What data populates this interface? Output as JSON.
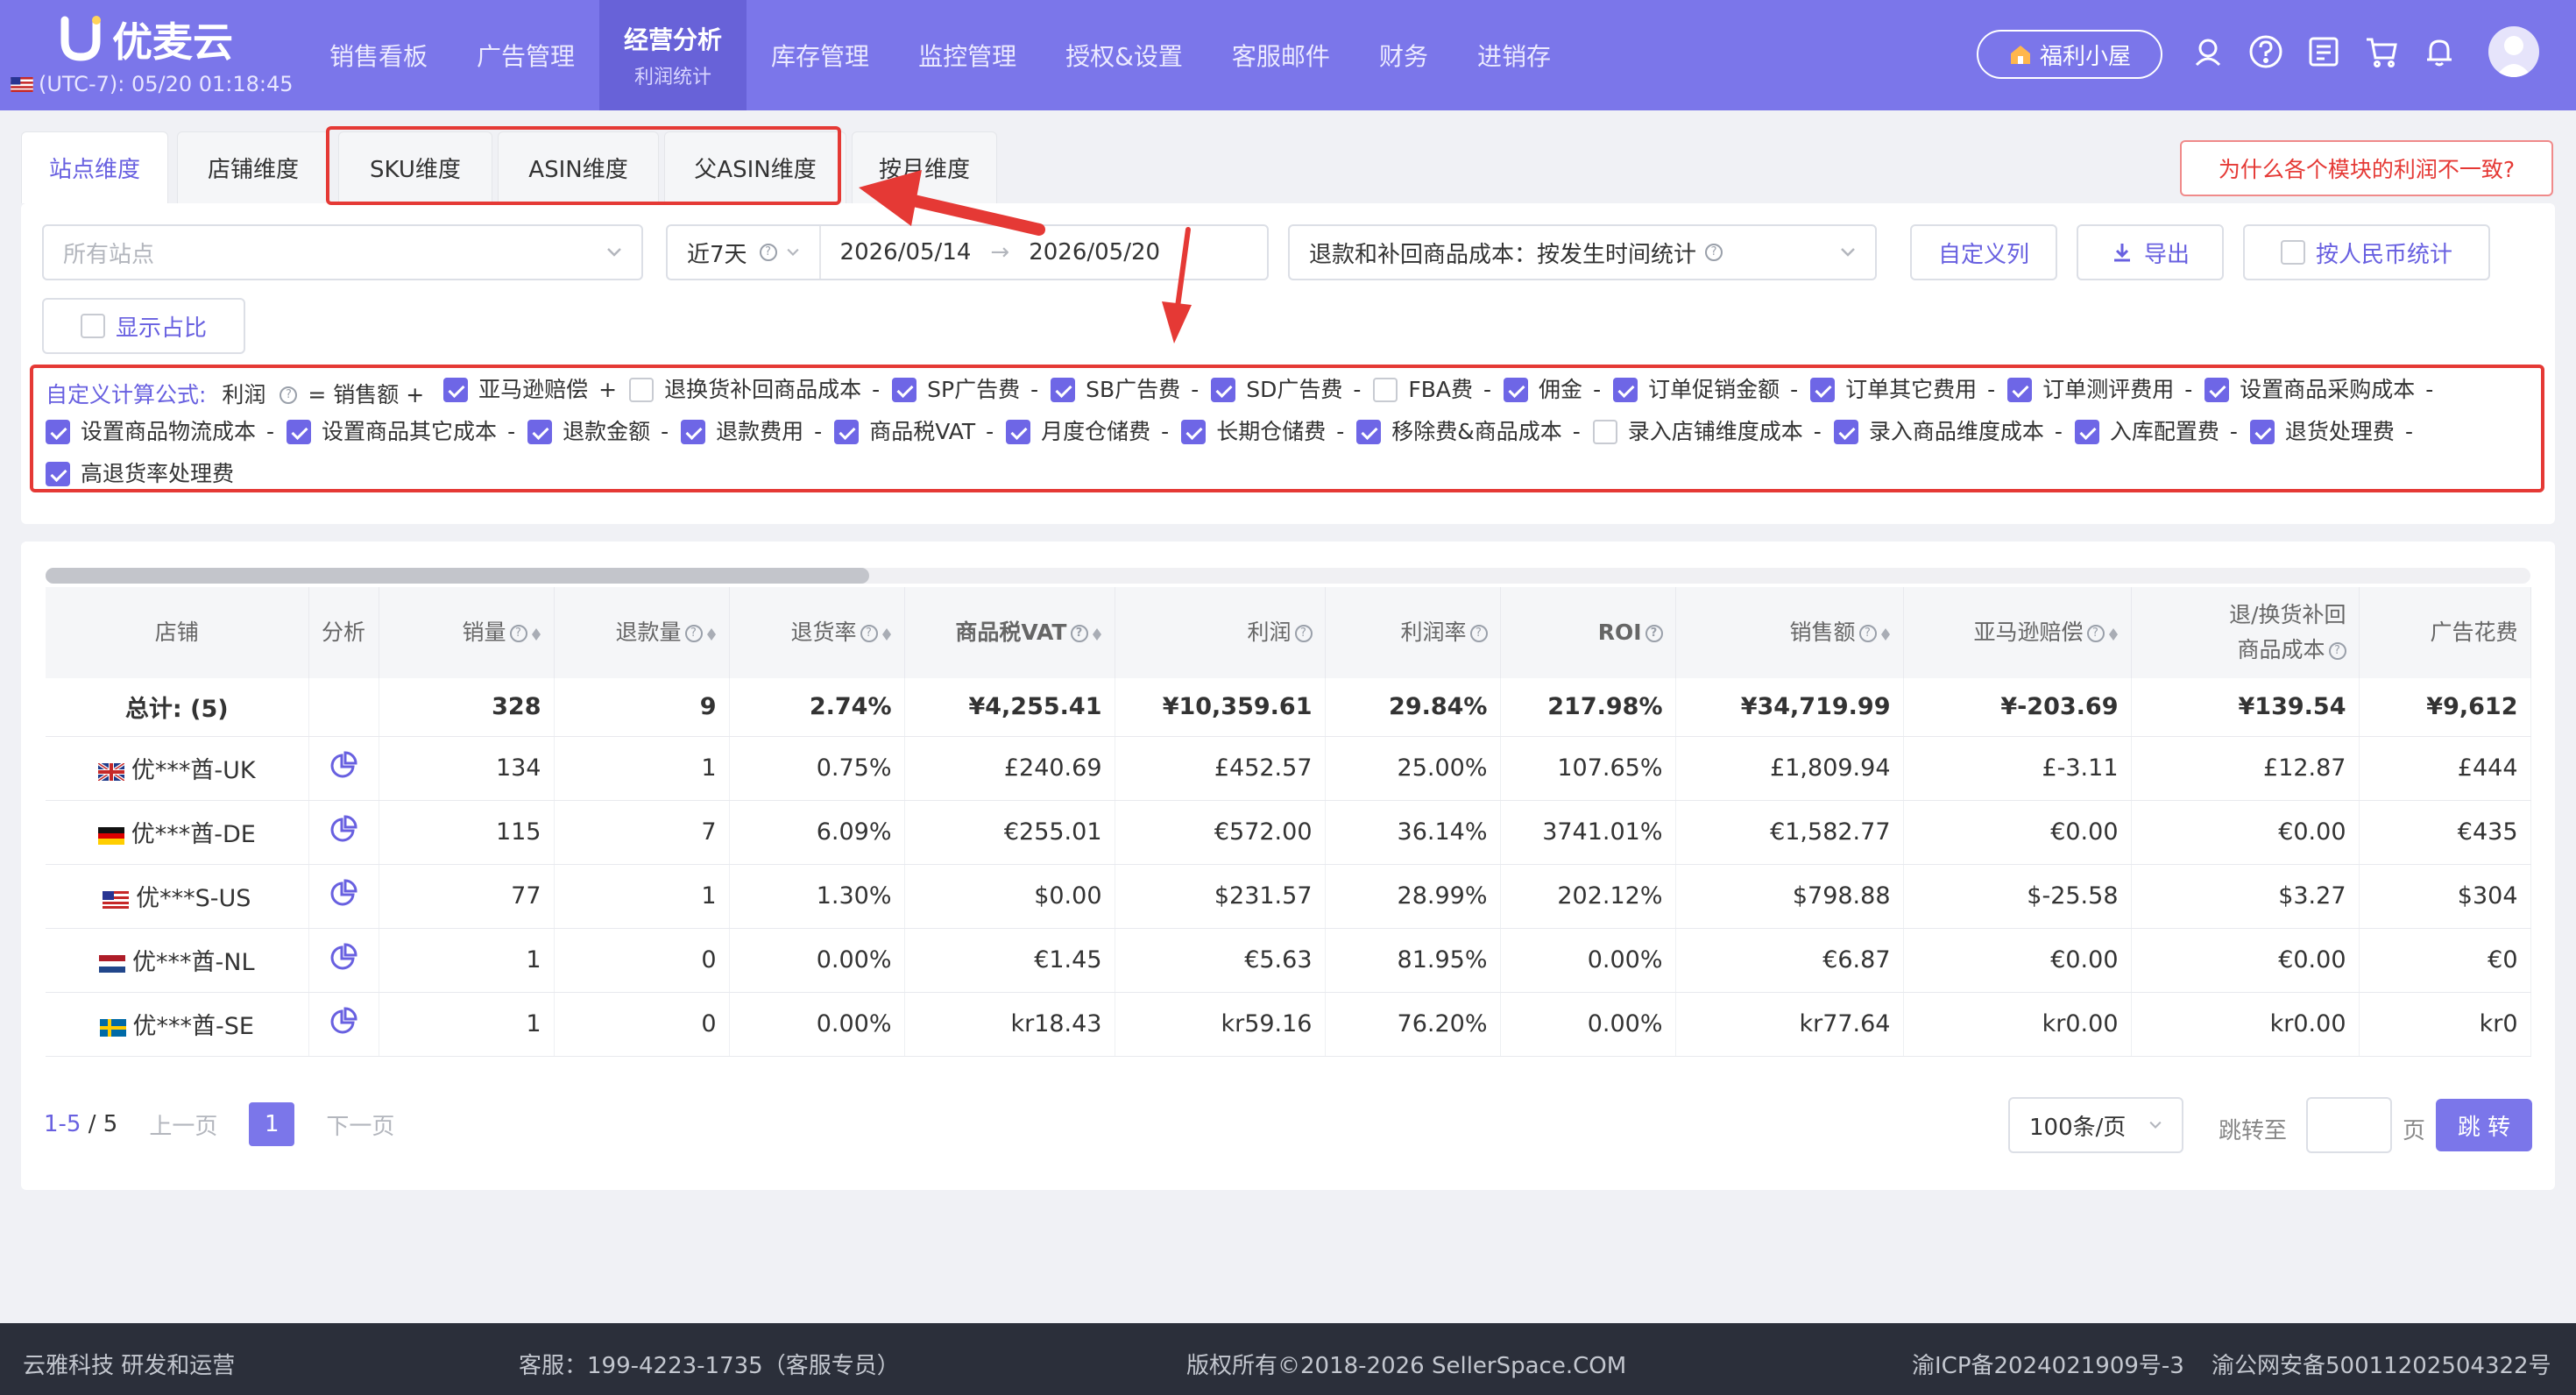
{
  "app": {
    "logo_text": "优麦云",
    "clock": "(UTC-7): 05/20 01:18:45"
  },
  "nav": [
    {
      "label": "销售看板"
    },
    {
      "label": "广告管理"
    },
    {
      "label": "经营分析",
      "sub": "利润统计",
      "active": true
    },
    {
      "label": "库存管理"
    },
    {
      "label": "监控管理"
    },
    {
      "label": "授权&设置"
    },
    {
      "label": "客服邮件"
    },
    {
      "label": "财务"
    },
    {
      "label": "进销存"
    }
  ],
  "header": {
    "fuli_label": "福利小屋"
  },
  "tabs": [
    "站点维度",
    "店铺维度",
    "SKU维度",
    "ASIN维度",
    "父ASIN维度",
    "按月维度"
  ],
  "why_button": "为什么各个模块的利润不一致?",
  "filters": {
    "site_placeholder": "所有站点",
    "range_label": "近7天",
    "start_date": "2026/05/14",
    "date_sep": "→",
    "end_date": "2026/05/20",
    "refund_cost": "退款和补回商品成本：按发生时间统计",
    "custom_columns": "自定义列",
    "export": "导出",
    "rmb_stat": "按人民币统计",
    "show_ratio": "显示占比"
  },
  "formula": {
    "label": "自定义计算公式:",
    "head": "利润",
    "eq": "= 销售额 +",
    "terms": [
      {
        "label": "亚马逊赔偿",
        "op": "+",
        "checked": true
      },
      {
        "label": "退换货补回商品成本",
        "op": "-",
        "checked": false
      },
      {
        "label": "SP广告费",
        "op": "-",
        "checked": true
      },
      {
        "label": "SB广告费",
        "op": "-",
        "checked": true
      },
      {
        "label": "SD广告费",
        "op": "-",
        "checked": true
      },
      {
        "label": "FBA费",
        "op": "-",
        "checked": false
      },
      {
        "label": "佣金",
        "op": "-",
        "checked": true
      },
      {
        "label": "订单促销金额",
        "op": "-",
        "checked": true
      },
      {
        "label": "订单其它费用",
        "op": "-",
        "checked": true
      },
      {
        "label": "订单测评费用",
        "op": "-",
        "checked": true
      },
      {
        "label": "设置商品采购成本",
        "op": "-",
        "checked": true
      },
      {
        "label": "设置商品物流成本",
        "op": "-",
        "checked": true
      },
      {
        "label": "设置商品其它成本",
        "op": "-",
        "checked": true
      },
      {
        "label": "退款金额",
        "op": "-",
        "checked": true
      },
      {
        "label": "退款费用",
        "op": "-",
        "checked": true
      },
      {
        "label": "商品税VAT",
        "op": "-",
        "checked": true
      },
      {
        "label": "月度仓储费",
        "op": "-",
        "checked": true
      },
      {
        "label": "长期仓储费",
        "op": "-",
        "checked": true
      },
      {
        "label": "移除费&商品成本",
        "op": "-",
        "checked": true
      },
      {
        "label": "录入店铺维度成本",
        "op": "-",
        "checked": false
      },
      {
        "label": "录入商品维度成本",
        "op": "-",
        "checked": true
      },
      {
        "label": "入库配置费",
        "op": "-",
        "checked": true
      },
      {
        "label": "退货处理费",
        "op": "-",
        "checked": true
      },
      {
        "label": "高退货率处理费",
        "op": "",
        "checked": true
      }
    ]
  },
  "table": {
    "columns": [
      {
        "label": "店铺"
      },
      {
        "label": "分析"
      },
      {
        "label": "销量",
        "help": true,
        "sort": true
      },
      {
        "label": "退款量",
        "help": true,
        "sort": true
      },
      {
        "label": "退货率",
        "help": true,
        "sort": true
      },
      {
        "label": "商品税VAT",
        "help": true,
        "sort": true
      },
      {
        "label": "利润",
        "help": true
      },
      {
        "label": "利润率",
        "help": true
      },
      {
        "label": "ROI",
        "help": true
      },
      {
        "label": "销售额",
        "help": true,
        "sort": true
      },
      {
        "label": "亚马逊赔偿",
        "help": true,
        "sort": true
      },
      {
        "label": "退/换货补回",
        "label2": "商品成本",
        "help": true
      },
      {
        "label": "广告花费"
      }
    ],
    "total": [
      "总计: (5)",
      "",
      "328",
      "9",
      "2.74%",
      "¥4,255.41",
      "¥10,359.61",
      "29.84%",
      "217.98%",
      "¥34,719.99",
      "¥-203.69",
      "¥139.54",
      "¥9,612"
    ],
    "rows": [
      {
        "flag": "UK",
        "cells": [
          "优***酋-UK",
          "",
          "134",
          "1",
          "0.75%",
          "£240.69",
          "£452.57",
          "25.00%",
          "107.65%",
          "£1,809.94",
          "£-3.11",
          "£12.87",
          "£444"
        ]
      },
      {
        "flag": "DE",
        "cells": [
          "优***酋-DE",
          "",
          "115",
          "7",
          "6.09%",
          "€255.01",
          "€572.00",
          "36.14%",
          "3741.01%",
          "€1,582.77",
          "€0.00",
          "€0.00",
          "€435"
        ]
      },
      {
        "flag": "US",
        "cells": [
          "优***S-US",
          "",
          "77",
          "1",
          "1.30%",
          "$0.00",
          "$231.57",
          "28.99%",
          "202.12%",
          "$798.88",
          "$-25.58",
          "$3.27",
          "$304"
        ]
      },
      {
        "flag": "NL",
        "cells": [
          "优***酋-NL",
          "",
          "1",
          "0",
          "0.00%",
          "€1.45",
          "€5.63",
          "81.95%",
          "0.00%",
          "€6.87",
          "€0.00",
          "€0.00",
          "€0"
        ]
      },
      {
        "flag": "SE",
        "cells": [
          "优***酋-SE",
          "",
          "1",
          "0",
          "0.00%",
          "kr18.43",
          "kr59.16",
          "76.20%",
          "0.00%",
          "kr77.64",
          "kr0.00",
          "kr0.00",
          "kr0"
        ]
      }
    ]
  },
  "pager": {
    "range": "1-5",
    "sep": "/",
    "total": "5",
    "prev": "上一页",
    "page": "1",
    "next": "下一页",
    "page_size": "100条/页",
    "jump_to": "跳转至",
    "page_unit": "页",
    "jump_button": "跳 转"
  },
  "footer": {
    "company": "云雅科技 研发和运营",
    "support": "客服：199-4223-1735（客服专员）",
    "copyright": "版权所有©2018-2026 SellerSpace.COM",
    "icp": "渝ICP备2024021909号-3",
    "police": "渝公网安备50011202504322号"
  },
  "colors": {
    "primary": "#7b76ea",
    "annotation_red": "#e53935"
  }
}
